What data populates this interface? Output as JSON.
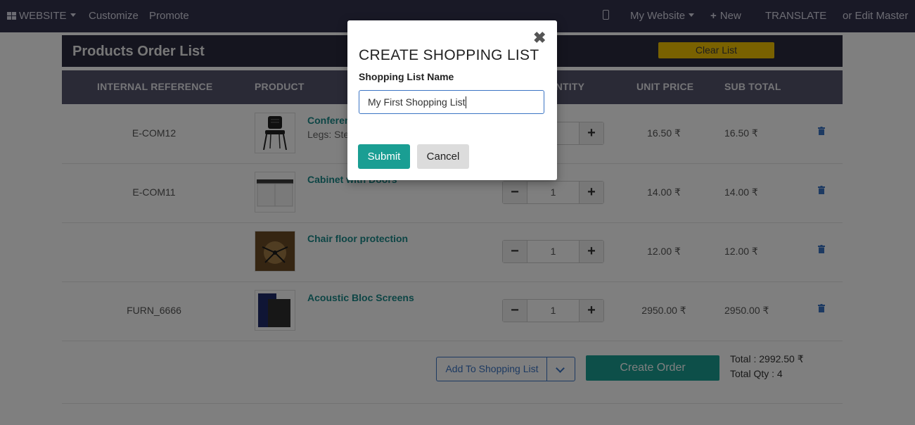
{
  "topbar": {
    "website_label": "WEBSITE",
    "customize_label": "Customize",
    "promote_label": "Promote",
    "my_website_label": "My Website",
    "new_label": "New",
    "translate_label": "TRANSLATE",
    "edit_master_label": "or Edit Master"
  },
  "panel": {
    "title": "Products Order List",
    "clear_label": "Clear List"
  },
  "table": {
    "headers": {
      "ref": "INTERNAL REFERENCE",
      "product": "PRODUCT",
      "qty": "QUANTITY",
      "unit_price": "UNIT PRICE",
      "sub_total": "SUB TOTAL"
    },
    "rows": [
      {
        "ref": "E-COM12",
        "name": "Conference Chair",
        "variant": "Legs: Steel",
        "qty": "",
        "unit_price": "16.50 ₹",
        "sub_total": "16.50 ₹"
      },
      {
        "ref": "E-COM11",
        "name": "Cabinet with Doors",
        "variant": "",
        "qty": "1",
        "unit_price": "14.00 ₹",
        "sub_total": "14.00 ₹"
      },
      {
        "ref": "",
        "name": "Chair floor protection",
        "variant": "",
        "qty": "1",
        "unit_price": "12.00 ₹",
        "sub_total": "12.00 ₹"
      },
      {
        "ref": "FURN_6666",
        "name": "Acoustic Bloc Screens",
        "variant": "",
        "qty": "1",
        "unit_price": "2950.00 ₹",
        "sub_total": "2950.00 ₹"
      }
    ]
  },
  "footer": {
    "add_to_list_label": "Add To Shopping List",
    "create_order_label": "Create Order",
    "total": "Total : 2992.50 ₹",
    "total_qty": "Total Qty : 4"
  },
  "modal": {
    "close_glyph": "✖",
    "title": "CREATE SHOPPING LIST",
    "field_label": "Shopping List Name",
    "field_value": "My First Shopping List",
    "submit_label": "Submit",
    "cancel_label": "Cancel"
  },
  "colors": {
    "navbar": "#33324d",
    "accent_teal": "#1a9e93",
    "link_blue": "#3b74c4",
    "clear_yellow": "#f2c200"
  }
}
